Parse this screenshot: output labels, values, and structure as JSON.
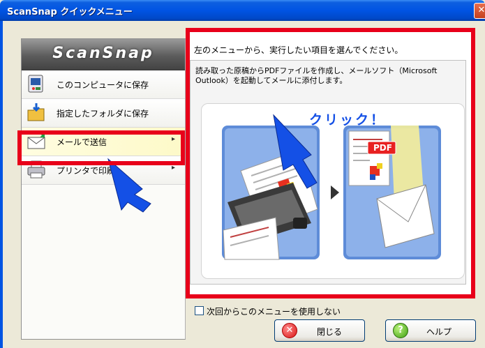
{
  "window": {
    "title": "ScanSnap クイックメニュー",
    "close_glyph": "✕"
  },
  "sidebar": {
    "logo": "ScanSnap",
    "items": [
      {
        "label": "このコンピュータに保存",
        "icon": "computer-save-icon",
        "has_submenu": false
      },
      {
        "label": "指定したフォルダに保存",
        "icon": "folder-save-icon",
        "has_submenu": false
      },
      {
        "label": "メールで送信",
        "icon": "mail-send-icon",
        "has_submenu": true,
        "selected": true
      },
      {
        "label": "プリンタで印刷",
        "icon": "printer-icon",
        "has_submenu": true
      }
    ],
    "submenu_glyph": "▸"
  },
  "panel": {
    "instruction": "左のメニューから、実行したい項目を選んでください。",
    "description": "読み取った原稿からPDFファイルを作成し、メールソフト（Microsoft Outlook）を起動してメールに添付します。",
    "illustration": {
      "click_label": "クリック！",
      "pdf_label": "PDF"
    }
  },
  "footer": {
    "checkbox_label": "次回からこのメニューを使用しない",
    "checkbox_checked": false,
    "close_button": "閉じる",
    "help_button": "ヘルプ",
    "help_glyph": "?",
    "close_glyph": "✕"
  },
  "colors": {
    "highlight": "#E8001A",
    "accent_blue": "#1450E6",
    "titlebar": "#0054E3"
  }
}
